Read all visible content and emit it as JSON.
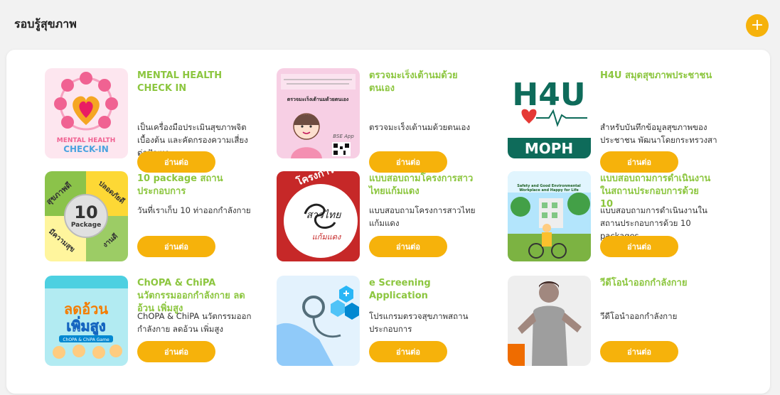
{
  "section": {
    "title": "รอบรู้สุขภาพ",
    "add_icon": "+"
  },
  "cards": [
    {
      "title": "MENTAL HEALTH CHECK IN",
      "desc": "เป็นเครื่องมือประเมินสุขภาพจิตเบื้องต้น และคัดกรองความเสี่ยงต่อปัญหา",
      "button": "อ่านต่อ",
      "thumb_text": [
        "MENTAL HEALTH",
        "CHECK-IN"
      ]
    },
    {
      "title": "ตรวจมะเร็งเต้านมด้วยตนเอง",
      "desc": "ตรวจมะเร็งเต้านมด้วยตนเอง",
      "button": "อ่านต่อ",
      "thumb_text": [
        "ตรวจมะเร็งเต้านมด้วยตนเอง",
        "BSE App"
      ]
    },
    {
      "title": "H4U สมุดสุขภาพประชาชน",
      "desc": "สำหรับบันทึกข้อมูลสุขภาพของประชาชน พัฒนาโดยกระทรวงสา",
      "button": "อ่านต่อ",
      "thumb_text": [
        "H4U",
        "MOPH"
      ]
    },
    {
      "title": "10 package สถานประกอบการ",
      "desc": "วันที่เราเก็บ 10 ท่าออกกำลังกาย",
      "button": "อ่านต่อ",
      "thumb_text": [
        "สุขภาพดี",
        "ปลอดภัยดี",
        "10",
        "Package",
        "มีความสุข",
        "งานดี"
      ]
    },
    {
      "title": "แบบสอบถามโครงการสาวไทยแก้มแดง",
      "desc": "แบบสอบถามโครงการสาวไทยแก้มแดง",
      "button": "อ่านต่อ",
      "thumb_text": [
        "โครงการ",
        "สาวไทย",
        "แก้มแดง"
      ]
    },
    {
      "title": "แบบสอบถามการดำเนินงานในสถานประกอบการด้วย 10",
      "desc": "แบบสอบถามการดำเนินงานในสถานประกอบการด้วย 10 packages",
      "button": "อ่านต่อ",
      "thumb_text": [
        "Safety and Good Environmental",
        "Workplace and Happy for Life"
      ]
    },
    {
      "title": "ChOPA & ChiPA นวัตกรรมออกกำลังกาย ลดอ้วน เพิ่มสูง",
      "desc": "ChOPA & ChiPA นวัตกรรมออกกำลังกาย ลดอ้วน เพิ่มสูง",
      "button": "อ่านต่อ",
      "thumb_text": [
        "ลดอ้วน",
        "เพิ่มสูง",
        "ChOPA & ChiPA Game"
      ]
    },
    {
      "title": "e Screening Application",
      "desc": "โปรแกรมตรวจสุขภาพสถานประกอบการ",
      "button": "อ่านต่อ",
      "thumb_text": []
    },
    {
      "title": "วีดีโอนำออกกำลังกาย",
      "desc": "วีดีโอนำออกกำลังกาย",
      "button": "อ่านต่อ",
      "thumb_text": []
    }
  ],
  "colors": {
    "accent": "#f6b20b",
    "title_green": "#8cc63f",
    "h4u_teal": "#0e6b5a",
    "thumb_pink": "#f7cfe4"
  }
}
